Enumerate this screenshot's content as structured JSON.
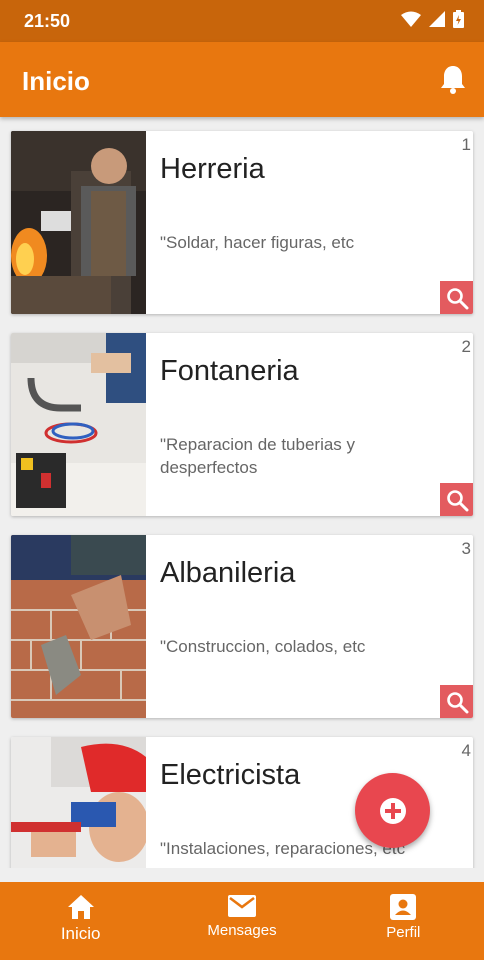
{
  "status_bar": {
    "time": "21:50"
  },
  "app_bar": {
    "title": "Inicio",
    "notification_icon": "bell-icon"
  },
  "cards": [
    {
      "number": "1",
      "name": "Herreria",
      "description": "\"Soldar, hacer figuras, etc"
    },
    {
      "number": "2",
      "name": "Fontaneria",
      "description": "\"Reparacion de tuberias y desperfectos"
    },
    {
      "number": "3",
      "name": "Albanileria",
      "description": "\"Construccion, colados, etc"
    },
    {
      "number": "4",
      "name": "Electricista",
      "description": "\"Instalaciones, reparaciones, etc"
    }
  ],
  "bottom_nav": [
    {
      "label": "Inicio",
      "icon": "home-icon",
      "active": true
    },
    {
      "label": "Mensages",
      "icon": "mail-icon",
      "active": false
    },
    {
      "label": "Perfil",
      "icon": "profile-icon",
      "active": false
    }
  ],
  "colors": {
    "primary": "#e8770f",
    "status_bar": "#c8650b",
    "accent": "#e35b5f",
    "fab": "#e8474f"
  }
}
